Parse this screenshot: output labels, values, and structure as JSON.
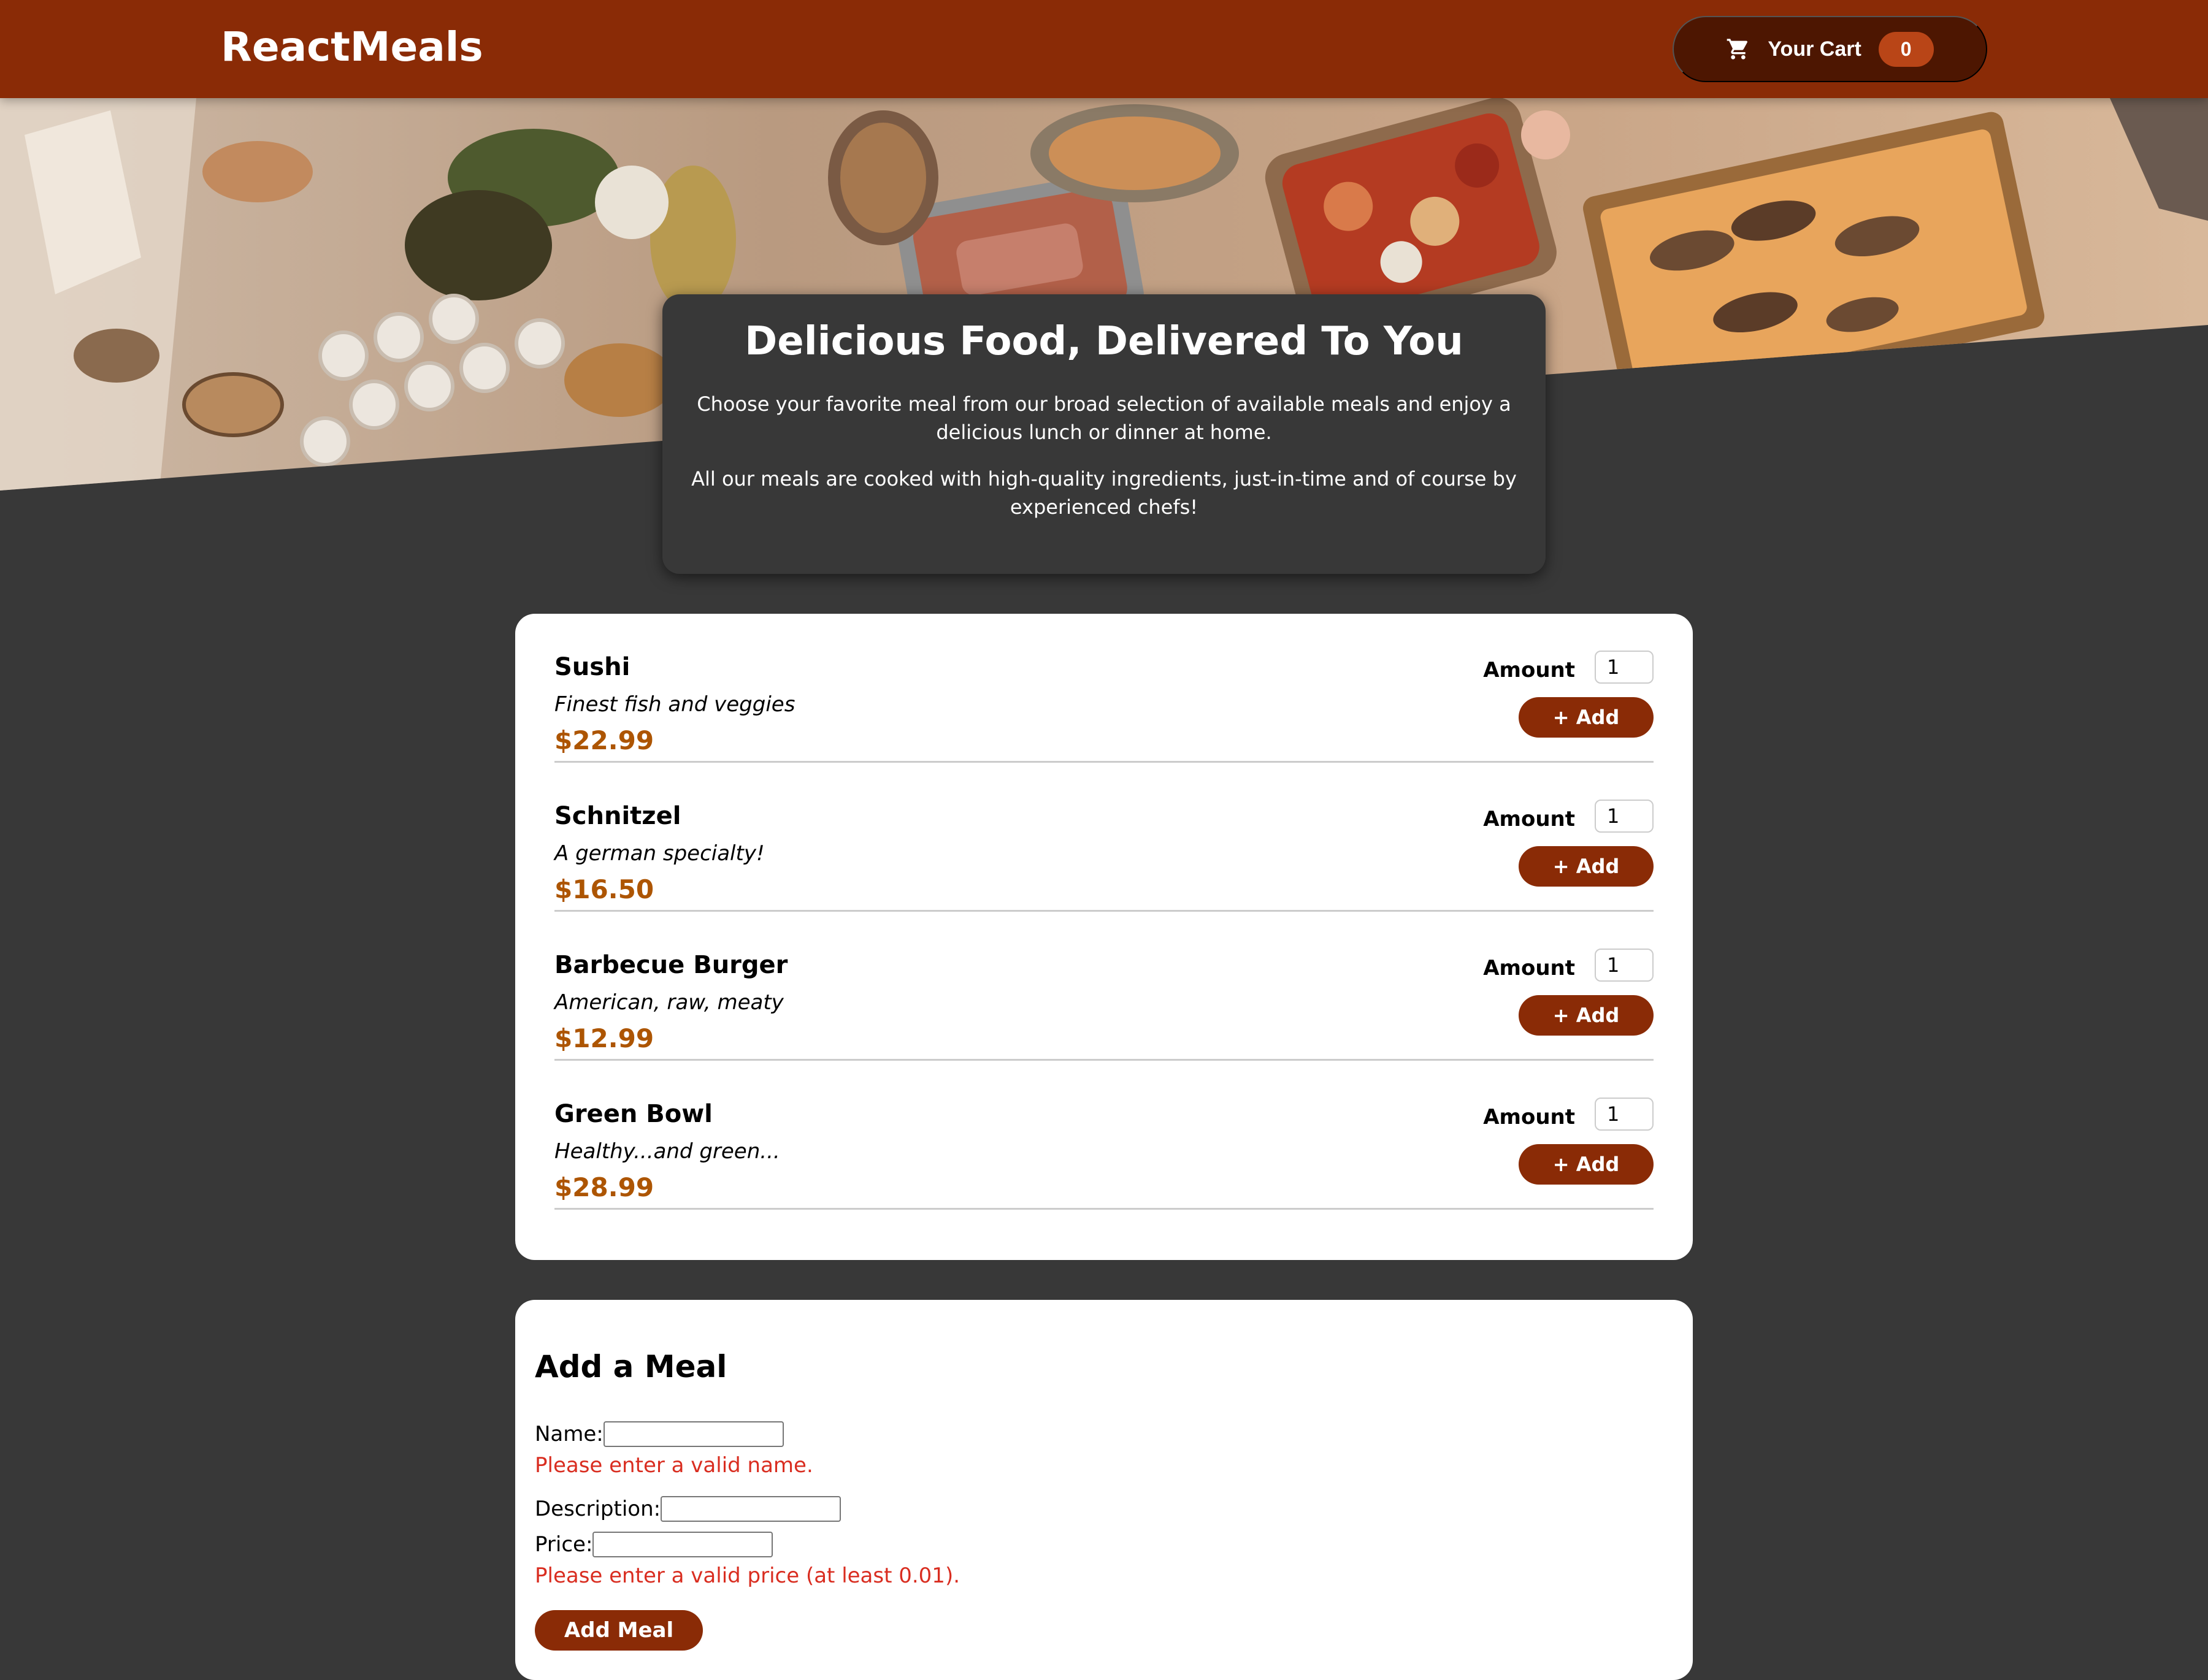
{
  "header": {
    "logo": "ReactMeals",
    "cart_label": "Your Cart",
    "cart_count": "0",
    "cart_icon": "cart-icon"
  },
  "summary": {
    "title": "Delicious Food, Delivered To You",
    "paragraph1": "Choose your favorite meal from our broad selection of available meals and enjoy a delicious lunch or dinner at home.",
    "paragraph2": "All our meals are cooked with high-quality ingredients, just-in-time and of course by experienced chefs!"
  },
  "meals": [
    {
      "name": "Sushi",
      "description": "Finest fish and veggies",
      "price": "$22.99",
      "amount_label": "Amount",
      "amount_value": "1",
      "add_label": "+ Add"
    },
    {
      "name": "Schnitzel",
      "description": "A german specialty!",
      "price": "$16.50",
      "amount_label": "Amount",
      "amount_value": "1",
      "add_label": "+ Add"
    },
    {
      "name": "Barbecue Burger",
      "description": "American, raw, meaty",
      "price": "$12.99",
      "amount_label": "Amount",
      "amount_value": "1",
      "add_label": "+ Add"
    },
    {
      "name": "Green Bowl",
      "description": "Healthy...and green...",
      "price": "$28.99",
      "amount_label": "Amount",
      "amount_value": "1",
      "add_label": "+ Add"
    }
  ],
  "add_meal_form": {
    "title": "Add a Meal",
    "name_label": "Name:",
    "name_value": "",
    "name_error": "Please enter a valid name.",
    "description_label": "Description:",
    "description_value": "",
    "price_label": "Price:",
    "price_value": "",
    "price_error": "Please enter a valid price (at least 0.01).",
    "submit_label": "Add Meal"
  },
  "colors": {
    "header": "#8a2b06",
    "cart_button": "#4d1601",
    "cart_badge": "#b94517",
    "background": "#383838",
    "price": "#ad5502",
    "error": "#d92d20"
  }
}
